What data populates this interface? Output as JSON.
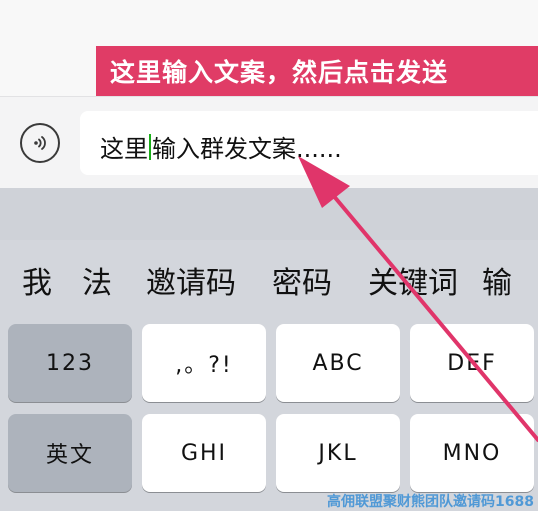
{
  "banner": {
    "text": "这里输入文案，然后点击发送"
  },
  "input": {
    "text_before_caret": "这里",
    "text_after_caret": "输入群发文案......"
  },
  "candidates": [
    "我",
    "法",
    "邀请码",
    "密码",
    "关键词",
    "输"
  ],
  "keys": {
    "row1": [
      "123",
      ",。?!",
      "ABC",
      "DEF"
    ],
    "row2": [
      "英文",
      "GHI",
      "JKL",
      "MNO"
    ]
  },
  "watermark": "高佣联盟聚财熊团队邀请码1688",
  "colors": {
    "banner": "#e03c66",
    "arrow": "#e0356a",
    "caret": "#1aad19"
  },
  "icons": {
    "voice": "voice-input-icon"
  }
}
